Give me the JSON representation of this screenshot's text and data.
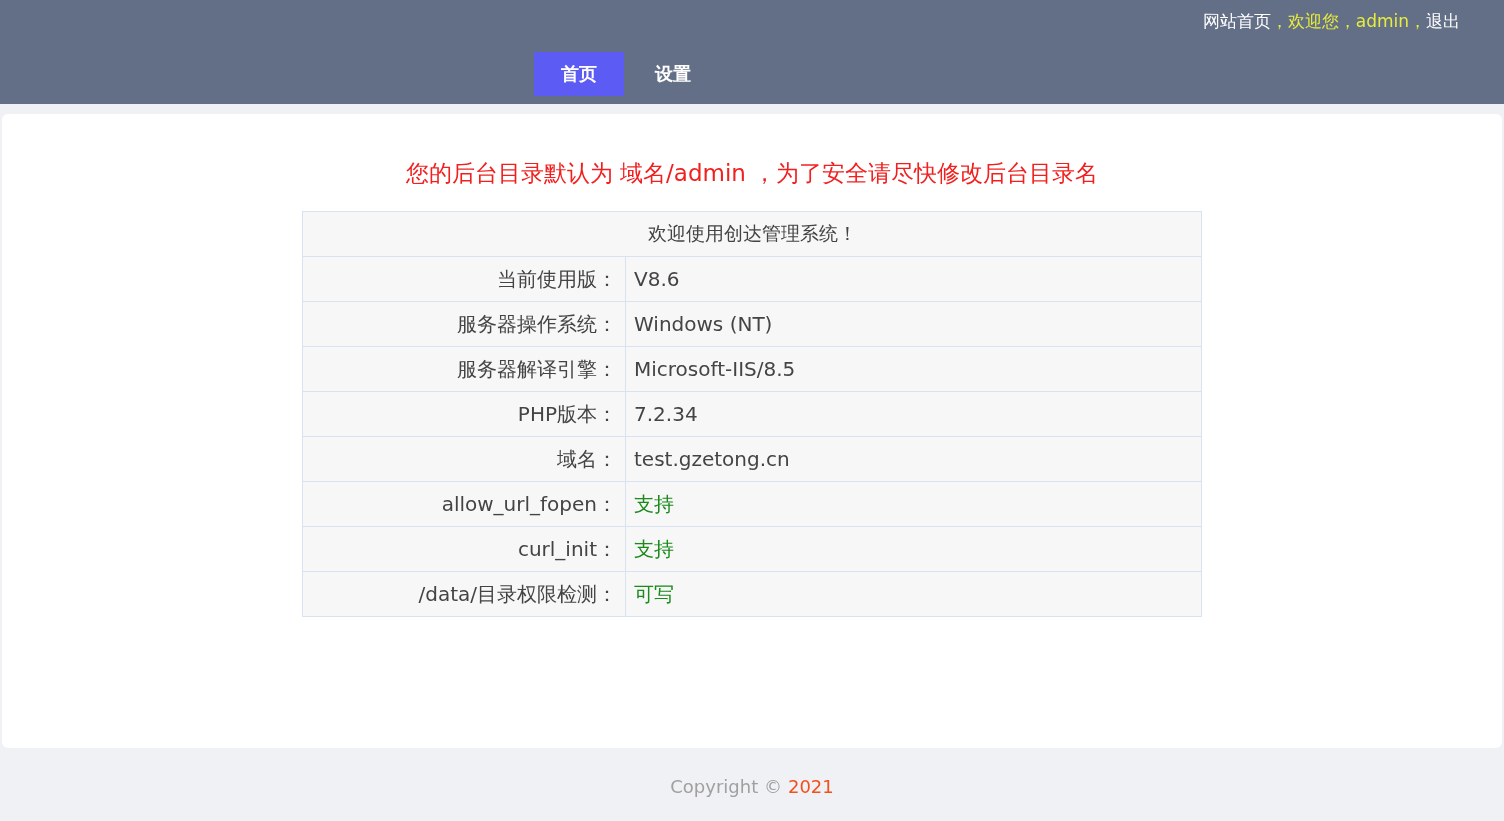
{
  "top_links": [
    {
      "text": "网站首页",
      "kind": "link"
    },
    {
      "text": "，欢迎您，admin，",
      "kind": "greeting"
    },
    {
      "text": "退出",
      "kind": "link"
    }
  ],
  "tabs": [
    {
      "label": "首页",
      "selected": true
    },
    {
      "label": "设置",
      "selected": false
    }
  ],
  "notice": "您的后台目录默认为 域名/admin ，为了安全请尽快修改后台目录名",
  "table": {
    "title": "欢迎使用创达管理系统！",
    "rows": [
      {
        "label": "当前使用版：",
        "value": "V8.6",
        "kind": "text"
      },
      {
        "label": "服务器操作系统：",
        "value": "Windows (NT)",
        "kind": "text"
      },
      {
        "label": "服务器解译引擎：",
        "value": "Microsoft-IIS/8.5",
        "kind": "text"
      },
      {
        "label": "PHP版本：",
        "value": "7.2.34",
        "kind": "text"
      },
      {
        "label": "域名：",
        "value": "test.gzetong.cn",
        "kind": "text"
      },
      {
        "label": "allow_url_fopen：",
        "value": "支持",
        "kind": "status"
      },
      {
        "label": "curl_init：",
        "value": "支持",
        "kind": "status"
      },
      {
        "label": "/data/目录权限检测：",
        "value": "可写",
        "kind": "status"
      }
    ]
  },
  "footer": {
    "copyright": "Copyright ©",
    "year": "2021"
  }
}
